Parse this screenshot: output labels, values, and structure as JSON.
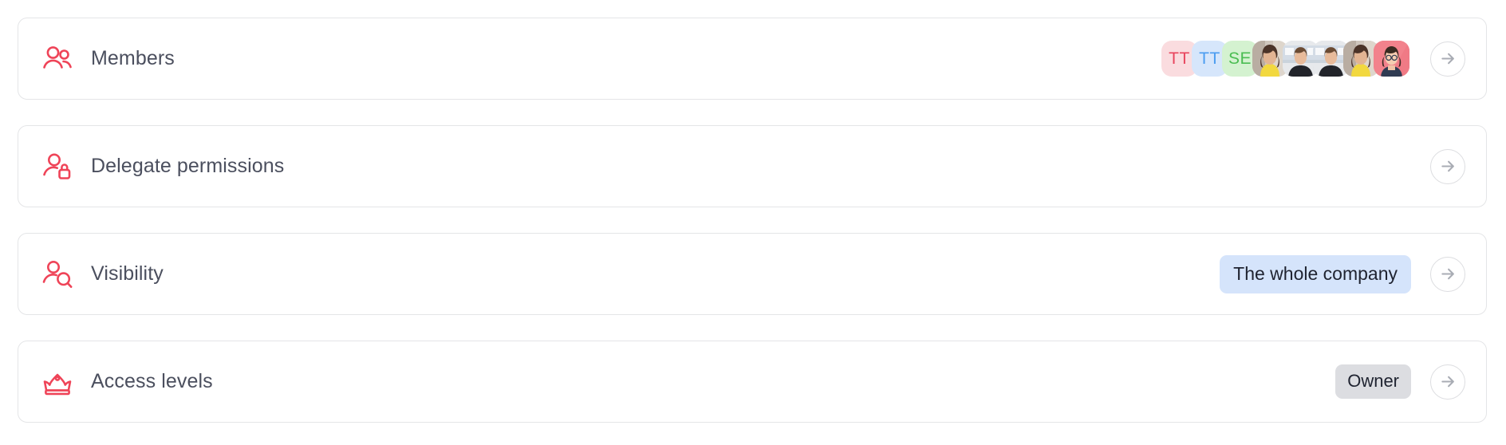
{
  "theme": {
    "accent": "#ef4458",
    "label_color": "#4b4f5e",
    "card_border": "#e4e5e7",
    "badge_blue_bg": "#d5e4fb",
    "badge_grey_bg": "#dcdde1",
    "arrow_color": "#a9acb4"
  },
  "rows": [
    {
      "id": "members",
      "label": "Members",
      "icon": "two-people-icon",
      "action_icon": "arrow-right-icon",
      "avatars": [
        {
          "type": "initials",
          "text": "TT",
          "bg": "#fadcdf",
          "fg": "#e8445c"
        },
        {
          "type": "initials",
          "text": "TT",
          "bg": "#d6e6fb",
          "fg": "#4a9cf0"
        },
        {
          "type": "initials",
          "text": "SE",
          "bg": "#d4f2d0",
          "fg": "#4bbd52"
        },
        {
          "type": "photo",
          "alt": "woman-in-yellow-top-photo"
        },
        {
          "type": "photo",
          "alt": "man-in-black-shirt-photo"
        },
        {
          "type": "photo",
          "alt": "man-in-black-shirt-photo"
        },
        {
          "type": "photo",
          "alt": "woman-in-yellow-top-photo"
        },
        {
          "type": "illustration",
          "alt": "woman-with-glasses-illustration",
          "bg": "#f2828c"
        }
      ]
    },
    {
      "id": "delegate-permissions",
      "label": "Delegate permissions",
      "icon": "person-lock-icon",
      "action_icon": "arrow-right-icon",
      "avatars": []
    },
    {
      "id": "visibility",
      "label": "Visibility",
      "icon": "person-search-icon",
      "action_icon": "arrow-right-icon",
      "badge": {
        "text": "The whole company",
        "style": "blue"
      },
      "avatars": []
    },
    {
      "id": "access-levels",
      "label": "Access levels",
      "icon": "crown-icon",
      "action_icon": "arrow-right-icon",
      "badge": {
        "text": "Owner",
        "style": "grey"
      },
      "avatars": []
    }
  ]
}
